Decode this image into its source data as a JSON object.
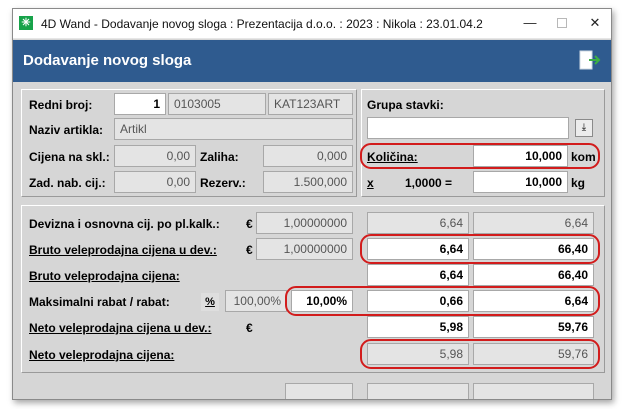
{
  "window": {
    "title": "4D Wand - Dodavanje novog sloga : Prezentacija d.o.o. : 2023 : Nikola : 23.01.04.2",
    "app_icon_glyph": "✳",
    "minimize_glyph": "—",
    "close_glyph": "✕"
  },
  "header": {
    "title": "Dodavanje novog sloga"
  },
  "article": {
    "redni_broj_label": "Redni broj:",
    "redni_broj": "1",
    "sifra": "0103005",
    "kat": "KAT123ART",
    "naziv_label": "Naziv artikla:",
    "naziv": "Artikl",
    "cijena_skl_label": "Cijena na skl.:",
    "cijena_skl": "0,00",
    "zaliha_label": "Zaliha:",
    "zaliha": "0,000",
    "zad_nab_label": "Zad. nab. cij.:",
    "zad_nab": "0,00",
    "rezerv_label": "Rezerv.:",
    "rezerv": "1.500,000"
  },
  "grupa": {
    "label": "Grupa stavki:",
    "value": "",
    "dropdown_glyph": "⤓"
  },
  "kolicina": {
    "label": "Količina:",
    "value": "10,000",
    "unit": "kom",
    "x_label": "x",
    "factor": "1,0000 =",
    "value2": "10,000",
    "unit2": "kg"
  },
  "prices": {
    "currency": "€",
    "rows": [
      {
        "label": "Devizna i osnovna cij. po pl.kalk.:",
        "rate": "1,00000000",
        "v1": "6,64",
        "v2": "6,64"
      },
      {
        "label": "Bruto veleprodajna cijena u dev.:",
        "rate": "1,00000000",
        "v1": "6,64",
        "v2": "66,40"
      },
      {
        "label": "Bruto veleprodajna cijena:",
        "v1": "6,64",
        "v2": "66,40"
      },
      {
        "label": "Maksimalni rabat / rabat:",
        "pct_button": "%",
        "max_rabat": "100,00%",
        "rabat": "10,00%",
        "v1": "0,66",
        "v2": "6,64"
      },
      {
        "label": "Neto veleprodajna cijena u dev.:",
        "v1": "5,98",
        "v2": "59,76"
      },
      {
        "label": "Neto veleprodajna cijena:",
        "v1": "5,98",
        "v2": "59,76"
      }
    ]
  },
  "colors": {
    "header": "#2f5b8f",
    "highlight": "#d21c1c",
    "panel": "#d6d6d6"
  }
}
